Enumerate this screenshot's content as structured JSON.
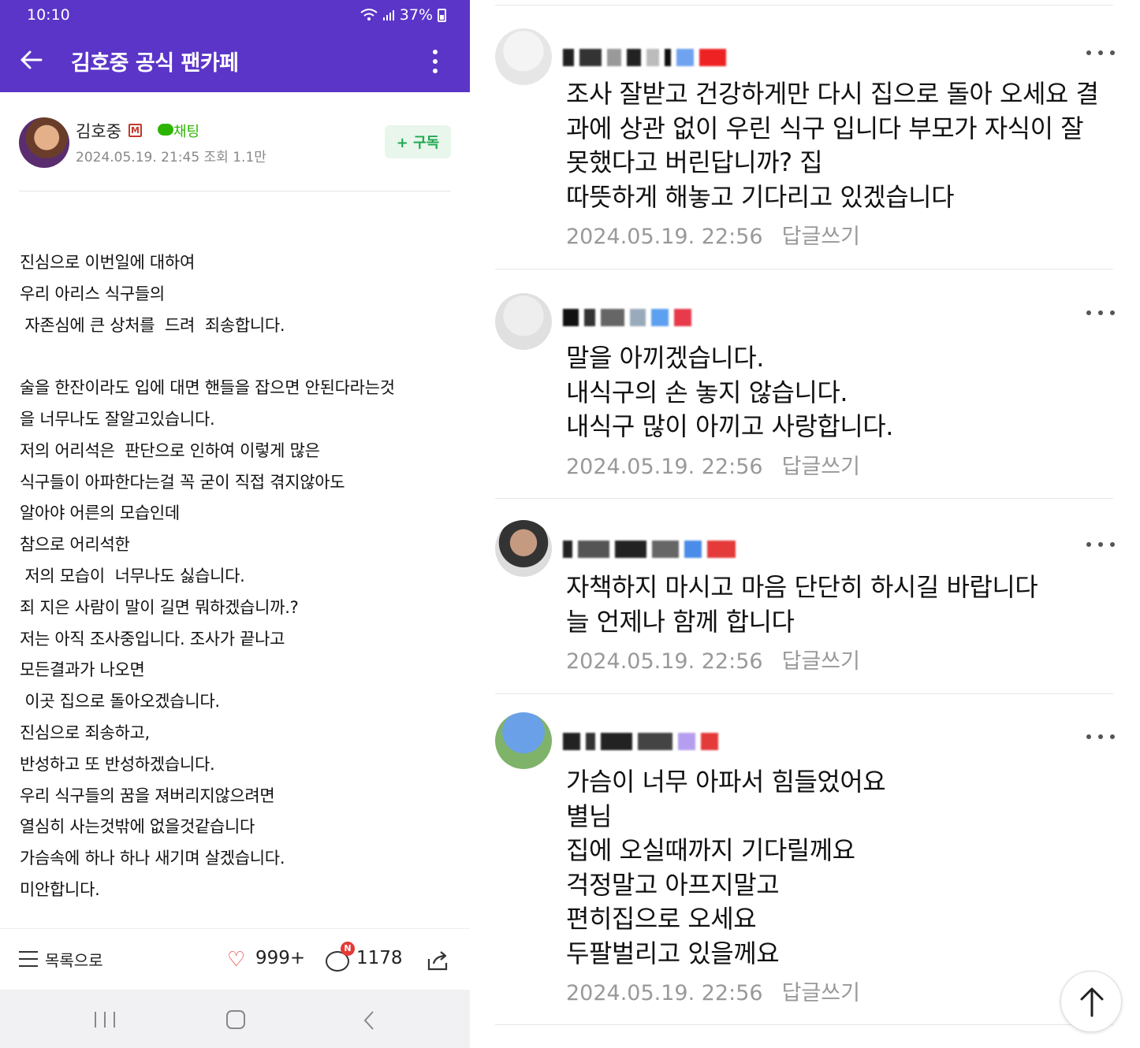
{
  "status": {
    "time": "10:10",
    "battery": "37%"
  },
  "appbar": {
    "title": "김호중 공식 팬카페"
  },
  "author": {
    "name": "김호중",
    "badge": "M",
    "chat_label": "채팅",
    "meta": "2024.05.19. 21:45  조회 1.1만",
    "subscribe_label": "+ 구독"
  },
  "post": {
    "lines": [
      "진심으로 이번일에 대하여",
      "우리 아리스 식구들의",
      " 자존심에 큰 상처를  드려  죄송합니다.",
      "",
      "술을 한잔이라도 입에 대면 핸들을 잡으면 안된다라는것",
      "을 너무나도 잘알고있습니다.",
      "저의 어리석은  판단으로 인하여 이렇게 많은",
      "식구들이 아파한다는걸 꼭 굳이 직접 겪지않아도",
      "알아야 어른의 모습인데",
      "참으로 어리석한",
      " 저의 모습이  너무나도 싫습니다.",
      "죄 지은 사람이 말이 길면 뭐하겠습니까.?",
      "저는 아직 조사중입니다. 조사가 끝나고",
      "모든결과가 나오면",
      " 이곳 집으로 돌아오겠습니다.",
      "진심으로 죄송하고,",
      "반성하고 또 반성하겠습니다.",
      "우리 식구들의 꿈을 져버리지않으려면",
      "열심히 사는것밖에 없을것같습니다",
      "가슴속에 하나 하나 새기며 살겠습니다.",
      "미안합니다."
    ]
  },
  "bottombar": {
    "list_label": "목록으로",
    "likes": "999+",
    "new_badge": "N",
    "comments": "1178"
  },
  "comments": [
    {
      "lines": [
        "조사 잘받고 건강하게만 다시 집으로 돌아 오세요 결",
        "과에 상관 없이 우린 식구 입니다 부모가 자식이 잘",
        "못했다고 버린답니까? 집",
        "따뜻하게 해놓고 기다리고 있겠습니다"
      ],
      "date": "2024.05.19. 22:56",
      "reply_label": "답글쓰기"
    },
    {
      "lines": [
        "말을 아끼겠습니다.",
        "내식구의 손 놓지 않습니다.",
        "내식구 많이 아끼고 사랑합니다."
      ],
      "date": "2024.05.19. 22:56",
      "reply_label": "답글쓰기"
    },
    {
      "lines": [
        "자책하지 마시고 마음 단단히 하시길 바랍니다",
        "늘 언제나 함께 합니다"
      ],
      "date": "2024.05.19. 22:56",
      "reply_label": "답글쓰기"
    },
    {
      "lines": [
        "가슴이 너무 아파서 힘들었어요",
        "별님",
        "집에 오실때까지 기다릴께요",
        "걱정말고 아프지말고",
        "편히집으로 오세요",
        "두팔벌리고 있을께요"
      ],
      "date": "2024.05.19. 22:56",
      "reply_label": "답글쓰기"
    }
  ]
}
